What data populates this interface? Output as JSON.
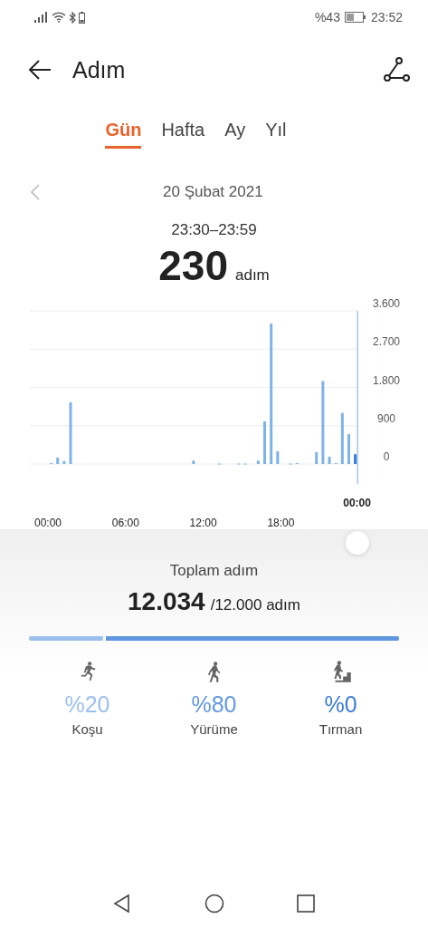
{
  "status_bar": {
    "battery_percent": "%43",
    "time": "23:52"
  },
  "header": {
    "title": "Adım"
  },
  "tabs": [
    {
      "label": "Gün",
      "selected": true
    },
    {
      "label": "Hafta",
      "selected": false
    },
    {
      "label": "Ay",
      "selected": false
    },
    {
      "label": "Yıl",
      "selected": false
    }
  ],
  "date": "20 Şubat 2021",
  "selection": {
    "time_range": "23:30–23:59",
    "value": "230",
    "unit": "adım"
  },
  "chart": {
    "selected_label": "00:00",
    "chart_data": {
      "type": "bar",
      "grid": true,
      "xlim": [
        0,
        24
      ],
      "ylim": [
        0,
        3600
      ],
      "yticks": [
        {
          "value": 0,
          "label": "0"
        },
        {
          "value": 900,
          "label": "900"
        },
        {
          "value": 1800,
          "label": "1.800"
        },
        {
          "value": 2700,
          "label": "2.700"
        },
        {
          "value": 3600,
          "label": "3.600"
        }
      ],
      "xticks": [
        {
          "value": 0,
          "label": "00:00"
        },
        {
          "value": 6,
          "label": "06:00"
        },
        {
          "value": 12,
          "label": "12:00"
        },
        {
          "value": 18,
          "label": "18:00"
        }
      ],
      "x": [
        0.25,
        0.75,
        1.25,
        1.75,
        11.25,
        13.25,
        14.75,
        15.25,
        16.25,
        16.75,
        17.25,
        17.75,
        18.75,
        19.25,
        20.75,
        21.25,
        21.75,
        22.25,
        22.75,
        23.25,
        23.75
      ],
      "series": [
        {
          "color": "#7fb2e8",
          "values": [
            20,
            150,
            70,
            1450,
            80,
            10,
            10,
            10,
            80,
            1000,
            3300,
            300,
            10,
            20,
            280,
            1950,
            170,
            20,
            1200,
            700,
            null
          ]
        },
        {
          "color": "#2f7ad6",
          "values": [
            null,
            null,
            null,
            null,
            null,
            null,
            null,
            null,
            null,
            null,
            null,
            null,
            null,
            null,
            null,
            null,
            null,
            null,
            null,
            null,
            230
          ]
        }
      ]
    }
  },
  "summary": {
    "label": "Toplam adım",
    "total": "12.034",
    "goal": "/12.000 adım"
  },
  "activities": [
    {
      "kind": "run",
      "percent": "%20",
      "label": "Koşu",
      "level": 0.2,
      "color": "#9cc0ee"
    },
    {
      "kind": "walk",
      "percent": "%80",
      "label": "Yürüme",
      "level": 0.8,
      "color": "#5f97e0"
    },
    {
      "kind": "climb",
      "percent": "%0",
      "label": "Tırman",
      "color": "#3a7bd8"
    }
  ]
}
